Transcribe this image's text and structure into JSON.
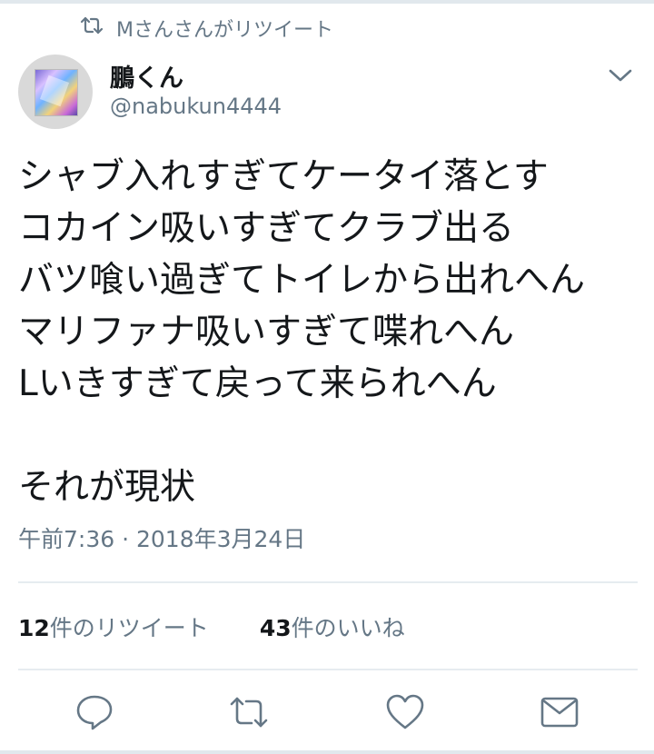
{
  "retweet_context": {
    "icon": "retweet-icon",
    "text": "Mさんさんがリツイート"
  },
  "author": {
    "display_name": "鵬くん",
    "handle": "@nabukun4444",
    "avatar": "avatar-image"
  },
  "tweet": {
    "lines": [
      "シャブ入れすぎてケータイ落とす",
      "コカイン吸いすぎてクラブ出る",
      "バツ喰い過ぎてトイレから出れへん",
      "マリファナ吸いすぎて喋れへん",
      "Lいきすぎて戻って来られへん",
      "",
      "それが現状"
    ],
    "timestamp": "午前7:36 · 2018年3月24日"
  },
  "stats": {
    "retweets_count": "12",
    "retweets_label": "件のリツイート",
    "likes_count": "43",
    "likes_label": "件のいいね"
  },
  "actions": [
    "reply-icon",
    "retweet-icon",
    "like-icon",
    "message-icon"
  ],
  "colors": {
    "text": "#14171a",
    "secondary": "#657786",
    "divider": "#e6ecf0"
  }
}
